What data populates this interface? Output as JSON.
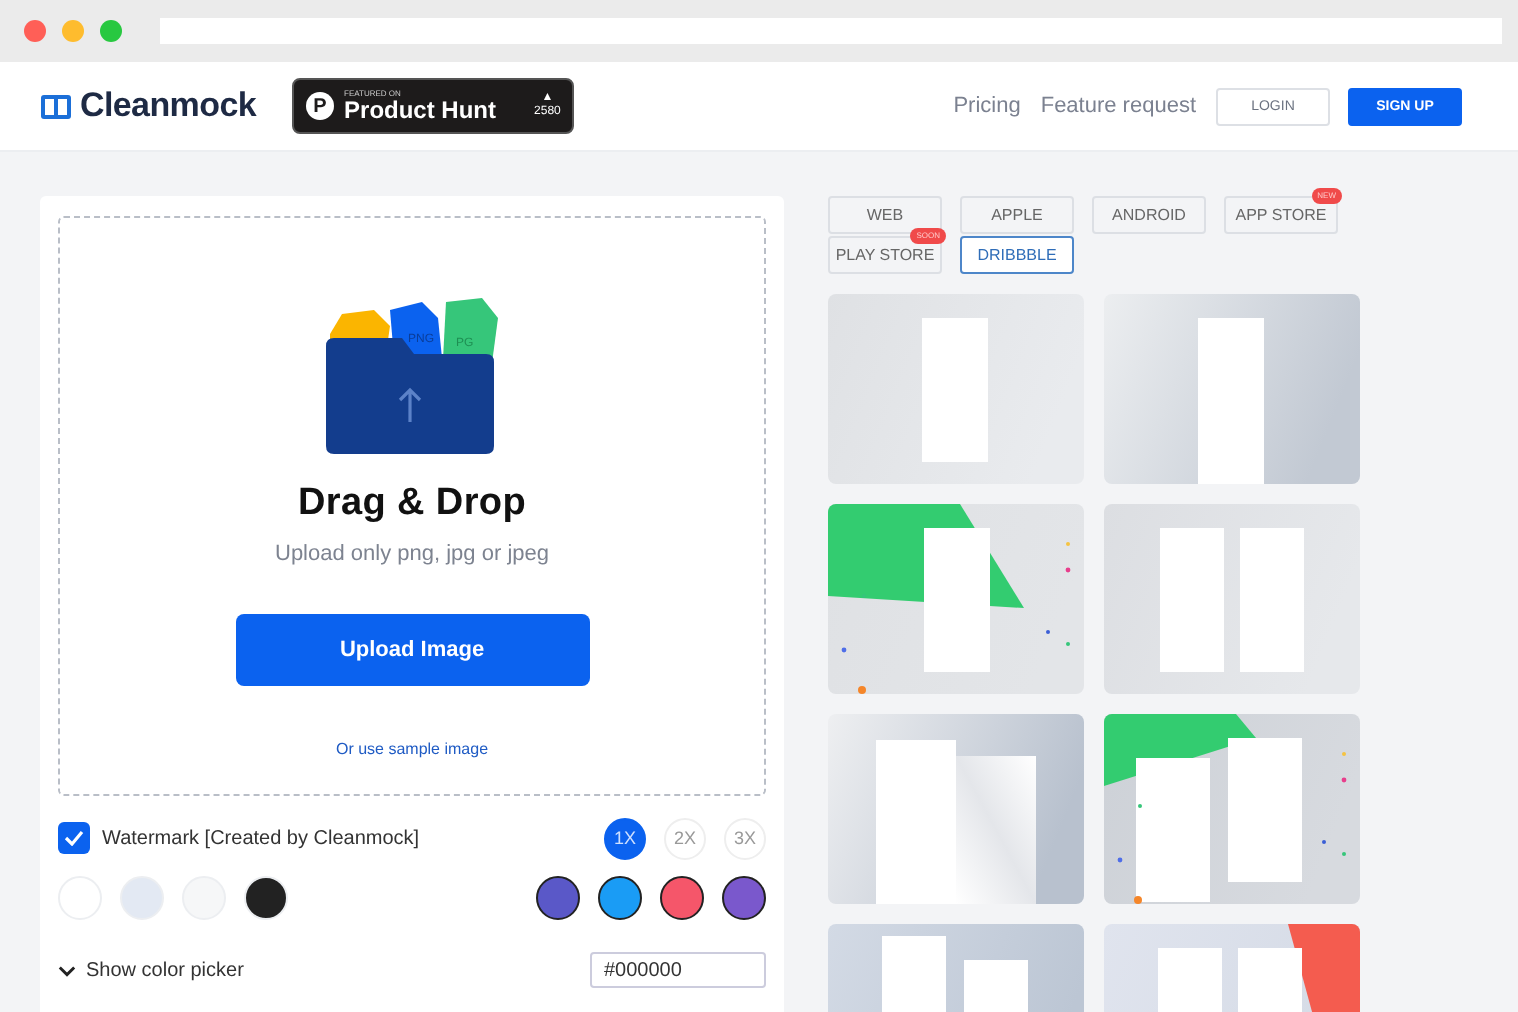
{
  "browser": {
    "dots": [
      {
        "color": "#ff5f57"
      },
      {
        "color": "#febc2e"
      },
      {
        "color": "#28c840"
      }
    ]
  },
  "header": {
    "logo": "Cleanmock",
    "badge": {
      "glyph": "P",
      "kicker": "FEATURED ON",
      "name": "Product Hunt",
      "arrow": "▲",
      "votes": "2580"
    },
    "links": [
      "Pricing",
      "Feature request"
    ],
    "buttons": [
      {
        "label": "LOGIN",
        "kind": "outline"
      },
      {
        "label": "SIGN UP",
        "kind": "primary"
      }
    ]
  },
  "upload": {
    "file_labels": [
      "PNG",
      "PG"
    ],
    "title": "Drag & Drop",
    "subtitle": "Upload only png, jpg or jpeg",
    "button": "Upload Image",
    "sample_link": "Or use sample image"
  },
  "watermark": {
    "label": "Watermark [Created by Cleanmock]",
    "checked": true
  },
  "scales": [
    {
      "label": "1X",
      "selected": true
    },
    {
      "label": "2X",
      "selected": false
    },
    {
      "label": "3X",
      "selected": false
    }
  ],
  "swatches": [
    {
      "kind": "solid",
      "color": "#ffffff"
    },
    {
      "kind": "solid",
      "color": "#e3e9f3"
    },
    {
      "kind": "solid",
      "color": "#f6f7f8"
    },
    {
      "kind": "solid",
      "color": "#222222"
    },
    {
      "kind": "ringed",
      "color": "#5a58c8"
    },
    {
      "kind": "ringed",
      "color": "#1a9cf5"
    },
    {
      "kind": "ringed",
      "color": "#f5566a"
    },
    {
      "kind": "ringed",
      "color": "#7a58cc"
    }
  ],
  "color_picker": {
    "label": "Show color picker",
    "expanded": false,
    "value": "#000000"
  },
  "platforms": [
    {
      "label": "WEB",
      "selected": false
    },
    {
      "label": "APPLE",
      "selected": false
    },
    {
      "label": "ANDROID",
      "selected": false
    },
    {
      "label": "APP STORE",
      "selected": false,
      "badge": "NEW"
    },
    {
      "label": "PLAY STORE",
      "selected": false,
      "badge": "SOON"
    },
    {
      "label": "DRIBBBLE",
      "selected": true
    }
  ],
  "templates": [
    {
      "kind": "single"
    },
    {
      "kind": "single-right"
    },
    {
      "kind": "confetti-single"
    },
    {
      "kind": "double"
    },
    {
      "kind": "overlap"
    },
    {
      "kind": "confetti-double"
    },
    {
      "kind": "double-low"
    },
    {
      "kind": "corner-double"
    }
  ]
}
